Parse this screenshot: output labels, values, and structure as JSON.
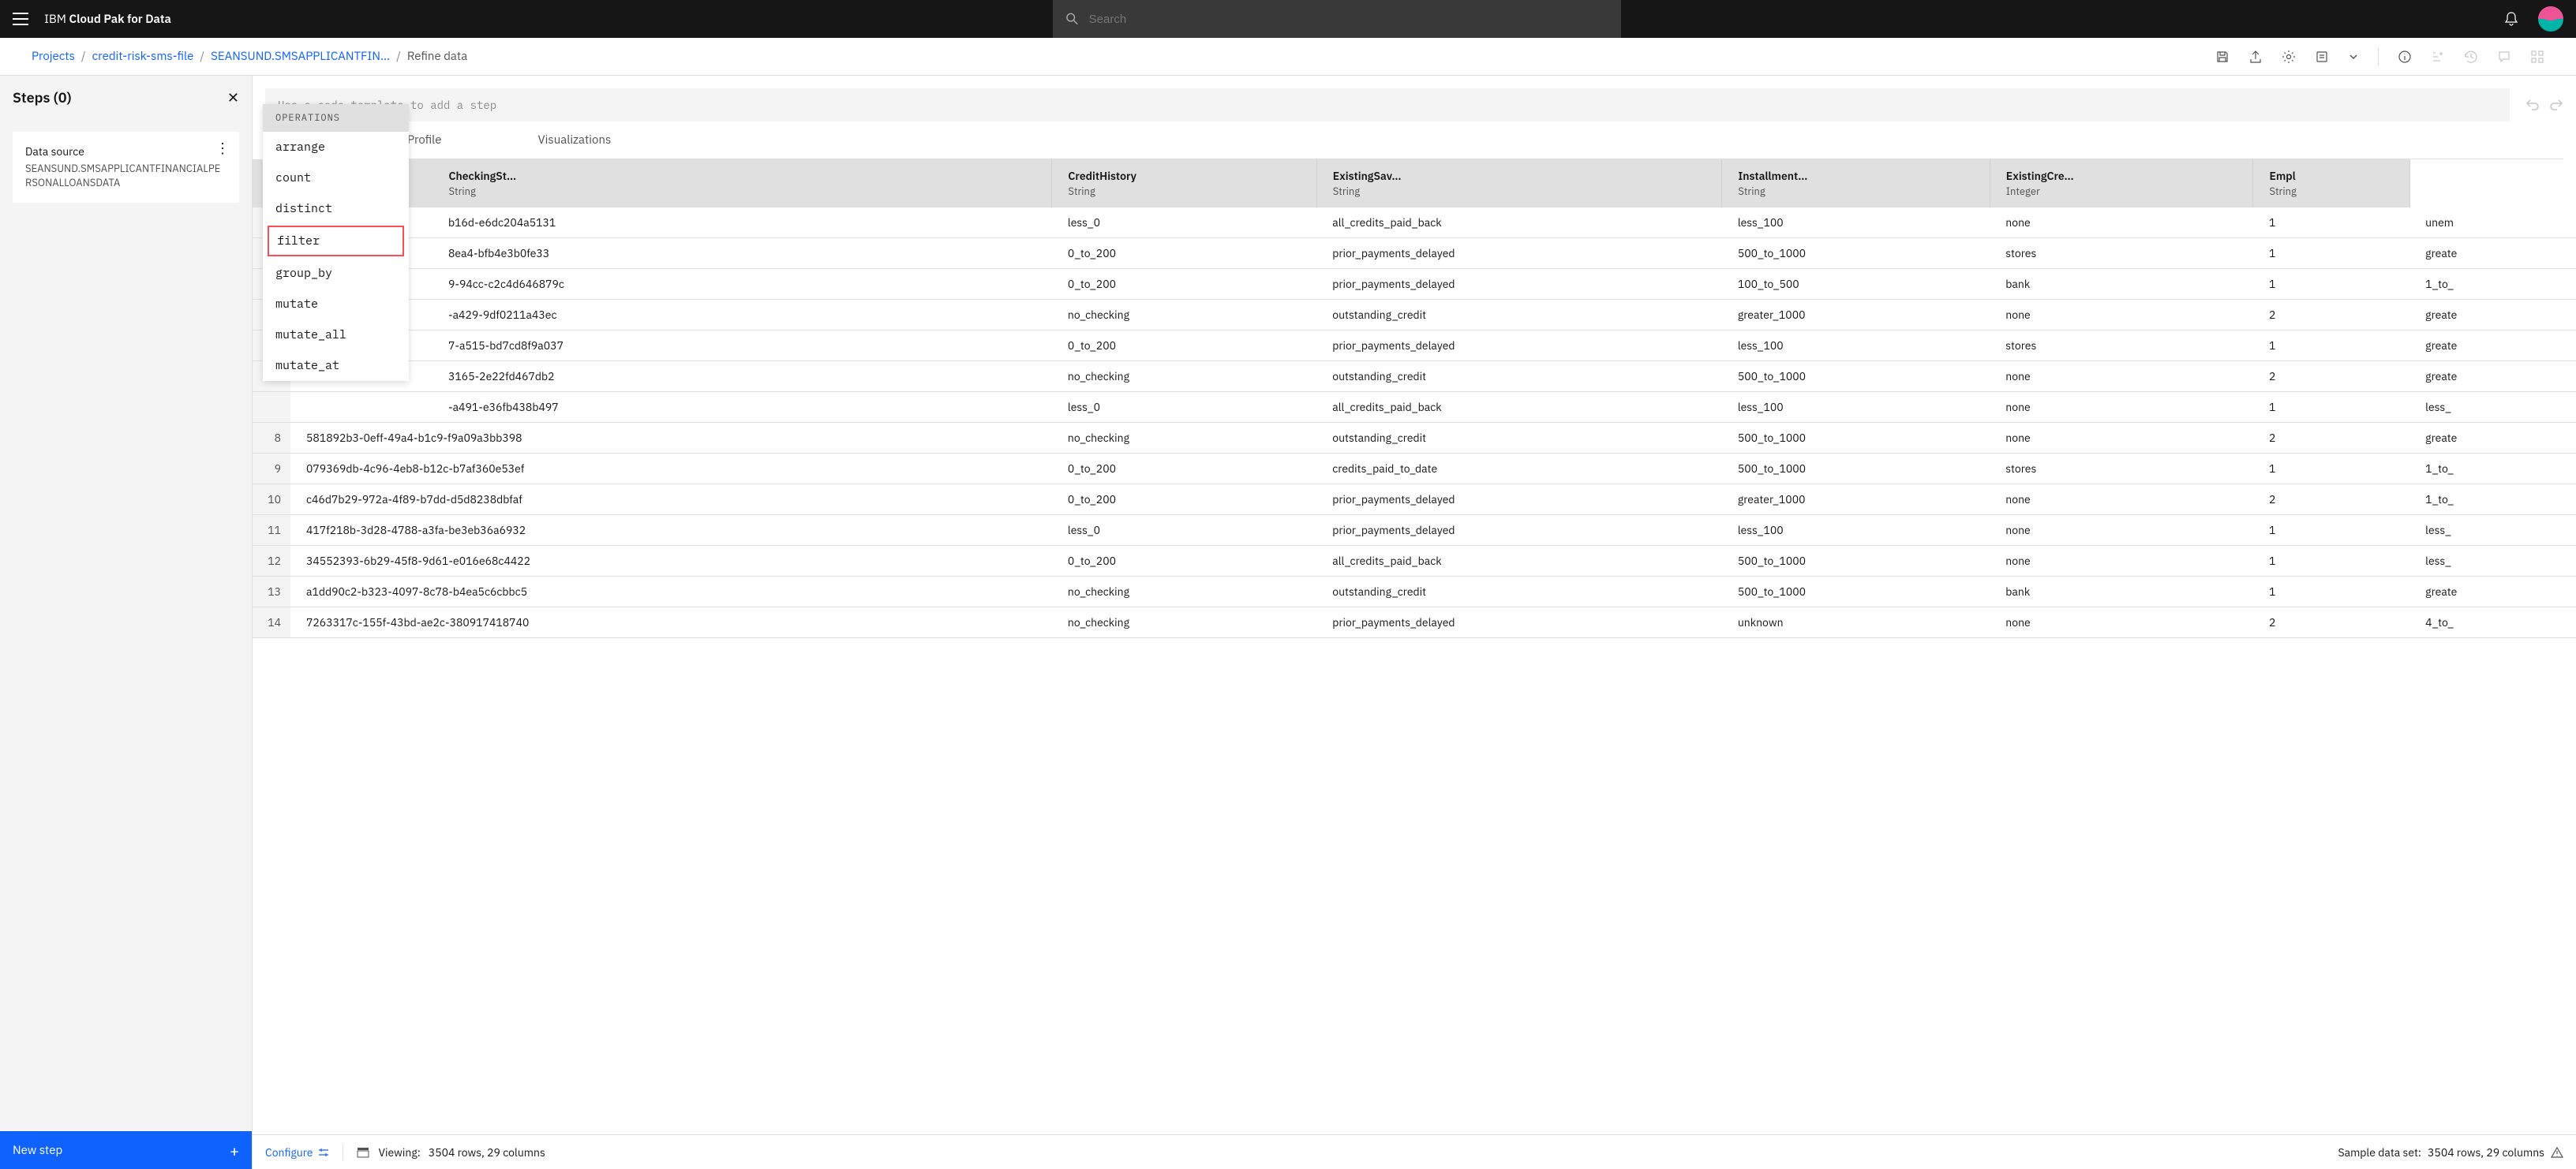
{
  "header": {
    "brand_prefix": "IBM ",
    "brand_bold": "Cloud Pak for Data",
    "search_placeholder": "Search"
  },
  "breadcrumb": {
    "items": [
      "Projects",
      "credit-risk-sms-file",
      "SEANSUND.SMSAPPLICANTFIN…"
    ],
    "current": "Refine data"
  },
  "steps": {
    "title": "Steps (0)",
    "data_source_label": "Data source",
    "data_source_value": "SEANSUND.SMSAPPLICANTFINANCIALPERSONALLOANSDATA",
    "new_step_label": "New step"
  },
  "code_input": {
    "placeholder": "Use a code template to add a step"
  },
  "operations": {
    "header": "OPERATIONS",
    "items": [
      "arrange",
      "count",
      "distinct",
      "filter",
      "group_by",
      "mutate",
      "mutate_all",
      "mutate_at"
    ],
    "highlighted": "filter"
  },
  "tabs": [
    "Profile",
    "Visualizations"
  ],
  "table": {
    "columns": [
      {
        "name": "",
        "type": ""
      },
      {
        "name": "CheckingSt…",
        "type": "String"
      },
      {
        "name": "CreditHistory",
        "type": "String"
      },
      {
        "name": "ExistingSav…",
        "type": "String"
      },
      {
        "name": "Installment…",
        "type": "String"
      },
      {
        "name": "ExistingCre…",
        "type": "Integer"
      },
      {
        "name": "Empl",
        "type": "String"
      }
    ],
    "rows": [
      {
        "n": "",
        "id": "b16d-e6dc204a5131",
        "c1": "less_0",
        "c2": "all_credits_paid_back",
        "c3": "less_100",
        "c4": "none",
        "c5": "1",
        "c6": "unem"
      },
      {
        "n": "",
        "id": "8ea4-bfb4e3b0fe33",
        "c1": "0_to_200",
        "c2": "prior_payments_delayed",
        "c3": "500_to_1000",
        "c4": "stores",
        "c5": "1",
        "c6": "greate"
      },
      {
        "n": "",
        "id": "9-94cc-c2c4d646879c",
        "c1": "0_to_200",
        "c2": "prior_payments_delayed",
        "c3": "100_to_500",
        "c4": "bank",
        "c5": "1",
        "c6": "1_to_"
      },
      {
        "n": "",
        "id": "-a429-9df0211a43ec",
        "c1": "no_checking",
        "c2": "outstanding_credit",
        "c3": "greater_1000",
        "c4": "none",
        "c5": "2",
        "c6": "greate"
      },
      {
        "n": "",
        "id": "7-a515-bd7cd8f9a037",
        "c1": "0_to_200",
        "c2": "prior_payments_delayed",
        "c3": "less_100",
        "c4": "stores",
        "c5": "1",
        "c6": "greate"
      },
      {
        "n": "",
        "id": "3165-2e22fd467db2",
        "c1": "no_checking",
        "c2": "outstanding_credit",
        "c3": "500_to_1000",
        "c4": "none",
        "c5": "2",
        "c6": "greate"
      },
      {
        "n": "",
        "id": "-a491-e36fb438b497",
        "c1": "less_0",
        "c2": "all_credits_paid_back",
        "c3": "less_100",
        "c4": "none",
        "c5": "1",
        "c6": "less_"
      },
      {
        "n": "8",
        "id": "581892b3-0eff-49a4-b1c9-f9a09a3bb398",
        "c1": "no_checking",
        "c2": "outstanding_credit",
        "c3": "500_to_1000",
        "c4": "none",
        "c5": "2",
        "c6": "greate"
      },
      {
        "n": "9",
        "id": "079369db-4c96-4eb8-b12c-b7af360e53ef",
        "c1": "0_to_200",
        "c2": "credits_paid_to_date",
        "c3": "500_to_1000",
        "c4": "stores",
        "c5": "1",
        "c6": "1_to_"
      },
      {
        "n": "10",
        "id": "c46d7b29-972a-4f89-b7dd-d5d8238dbfaf",
        "c1": "0_to_200",
        "c2": "prior_payments_delayed",
        "c3": "greater_1000",
        "c4": "none",
        "c5": "2",
        "c6": "1_to_"
      },
      {
        "n": "11",
        "id": "417f218b-3d28-4788-a3fa-be3eb36a6932",
        "c1": "less_0",
        "c2": "prior_payments_delayed",
        "c3": "less_100",
        "c4": "none",
        "c5": "1",
        "c6": "less_"
      },
      {
        "n": "12",
        "id": "34552393-6b29-45f8-9d61-e016e68c4422",
        "c1": "0_to_200",
        "c2": "all_credits_paid_back",
        "c3": "500_to_1000",
        "c4": "none",
        "c5": "1",
        "c6": "less_"
      },
      {
        "n": "13",
        "id": "a1dd90c2-b323-4097-8c78-b4ea5c6cbbc5",
        "c1": "no_checking",
        "c2": "outstanding_credit",
        "c3": "500_to_1000",
        "c4": "bank",
        "c5": "1",
        "c6": "greate"
      },
      {
        "n": "14",
        "id": "7263317c-155f-43bd-ae2c-380917418740",
        "c1": "no_checking",
        "c2": "prior_payments_delayed",
        "c3": "unknown",
        "c4": "none",
        "c5": "2",
        "c6": "4_to_"
      }
    ]
  },
  "footer": {
    "configure": "Configure",
    "viewing_label": "Viewing:",
    "viewing_value": "3504 rows, 29 columns",
    "sample_label": "Sample data set:",
    "sample_value": "3504 rows, 29 columns"
  }
}
